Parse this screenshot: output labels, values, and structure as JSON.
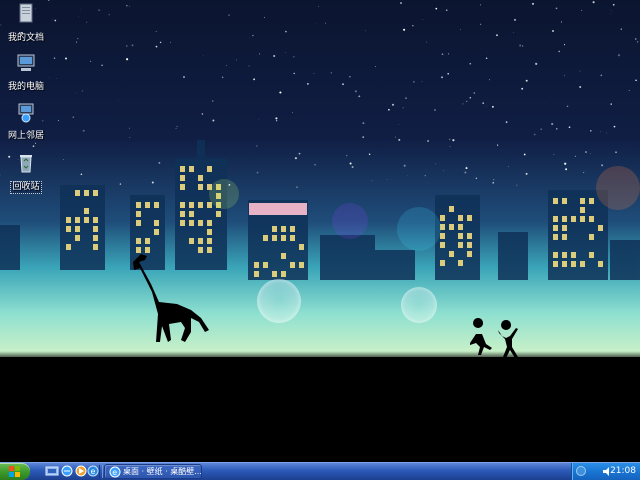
{
  "desktop": {
    "icons": [
      {
        "label": "我的文档",
        "icon": "my-documents-icon"
      },
      {
        "label": "我的电脑",
        "icon": "my-computer-icon"
      },
      {
        "label": "网上邻居",
        "icon": "network-places-icon"
      },
      {
        "label": "回收站",
        "icon": "recycle-bin-icon"
      }
    ]
  },
  "taskbar": {
    "start_icon": "windows-logo-icon",
    "quick_launch": [
      "show-desktop-icon",
      "internet-explorer-icon",
      "media-player-icon",
      "ie-icon"
    ],
    "task_button": {
      "label": "桌面 · 壁纸 · 桌酷壁...",
      "icon": "internet-explorer-icon"
    },
    "tray": {
      "icons": [
        "show-hidden-icons-chevron",
        "volume-icon"
      ],
      "clock": "21:08"
    }
  },
  "colors": {
    "taskbar": "#2f5dbb",
    "start": "#3d9b2c",
    "tray": "#1a75d3",
    "sky": "#0e1d3d",
    "ground": "#000000"
  }
}
